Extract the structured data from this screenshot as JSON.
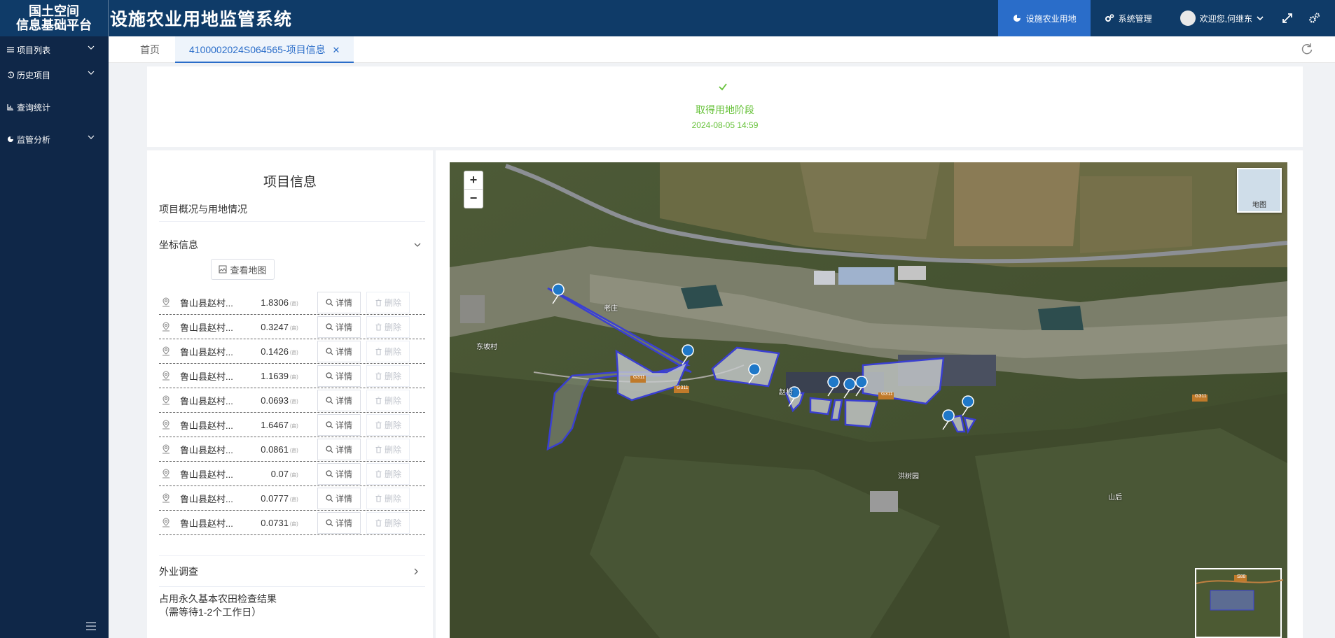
{
  "header": {
    "logo_line1": "国土空间",
    "logo_line2": "信息基础平台",
    "system_title": "设施农业用地监管系统",
    "nav": [
      {
        "label": "设施农业用地",
        "icon": "pie-icon",
        "active": true
      },
      {
        "label": "系统管理",
        "icon": "gears-icon",
        "active": false
      }
    ],
    "welcome": "欢迎您,何继东",
    "accent_color": "#2a6dc9",
    "bar_color": "#0f3b68"
  },
  "sidebar": {
    "items": [
      {
        "label": "项目列表",
        "icon": "list-icon",
        "has_chevron": true
      },
      {
        "label": "历史项目",
        "icon": "history-icon",
        "has_chevron": true
      },
      {
        "label": "查询统计",
        "icon": "bar-chart-icon",
        "has_chevron": false
      },
      {
        "label": "监管分析",
        "icon": "pie-icon",
        "has_chevron": true
      }
    ]
  },
  "tabs": [
    {
      "label": "首页",
      "active": false
    },
    {
      "label": "4100002024S064565-项目信息",
      "active": true,
      "closable": true
    }
  ],
  "status": {
    "title": "取得用地阶段",
    "time": "2024-08-05 14:59",
    "color": "#67c23a"
  },
  "project_panel": {
    "title": "项目信息",
    "overview_label": "项目概况与用地情况",
    "coord_label": "坐标信息",
    "view_map_label": "查看地图",
    "detail_label": "详情",
    "delete_label": "删除",
    "area_unit": "(亩)",
    "rows": [
      {
        "name": "鲁山县赵村...",
        "area": "1.8306"
      },
      {
        "name": "鲁山县赵村...",
        "area": "0.3247"
      },
      {
        "name": "鲁山县赵村...",
        "area": "0.1426"
      },
      {
        "name": "鲁山县赵村...",
        "area": "1.1639"
      },
      {
        "name": "鲁山县赵村...",
        "area": "0.0693"
      },
      {
        "name": "鲁山县赵村...",
        "area": "1.6467"
      },
      {
        "name": "鲁山县赵村...",
        "area": "0.0861"
      },
      {
        "name": "鲁山县赵村...",
        "area": "0.07"
      },
      {
        "name": "鲁山县赵村...",
        "area": "0.0777"
      },
      {
        "name": "鲁山县赵村...",
        "area": "0.0731"
      }
    ],
    "field_survey_label": "外业调查",
    "farmland_check_line1": "占用永久基本农田检查结果",
    "farmland_check_line2": "（需等待1-2个工作日）"
  },
  "map": {
    "zoom_in": "+",
    "zoom_out": "−",
    "layer_label": "地图",
    "road_labels": [
      "G311",
      "G311",
      "G311",
      "G311",
      "S88"
    ],
    "place_labels": [
      "东坡村",
      "老庄",
      "赵村",
      "洪树园",
      "山后"
    ],
    "parcel_color": "#3a3fd1"
  }
}
